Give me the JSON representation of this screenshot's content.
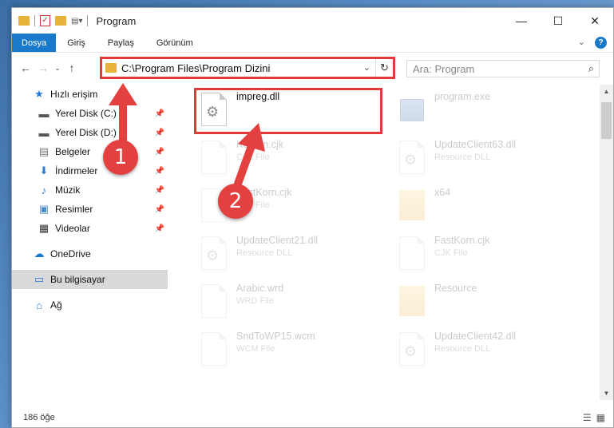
{
  "window": {
    "title": "Program",
    "controls": {
      "minimize": "—",
      "maximize": "☐",
      "close": "✕"
    }
  },
  "ribbon": {
    "tabs": [
      "Dosya",
      "Giriş",
      "Paylaş",
      "Görünüm"
    ],
    "active_tab": "Dosya",
    "expand": "⌄",
    "help": "?"
  },
  "address": {
    "path": "C:\\Program Files\\Program Dizini",
    "dropdown": "⌄",
    "refresh": "↻"
  },
  "search": {
    "placeholder": "Ara: Program",
    "icon": "search-icon"
  },
  "nav": {
    "items": [
      {
        "label": "Hızlı erişim",
        "icon": "star-icon",
        "pinned": false
      },
      {
        "label": "Yerel Disk (C:)",
        "icon": "drive-icon",
        "pinned": true
      },
      {
        "label": "Yerel Disk (D:)",
        "icon": "drive-icon",
        "pinned": true
      },
      {
        "label": "Belgeler",
        "icon": "documents-icon",
        "pinned": true
      },
      {
        "label": "İndirmeler",
        "icon": "download-icon",
        "pinned": true
      },
      {
        "label": "Müzik",
        "icon": "music-icon",
        "pinned": true
      },
      {
        "label": "Resimler",
        "icon": "pictures-icon",
        "pinned": true
      },
      {
        "label": "Videolar",
        "icon": "videos-icon",
        "pinned": true
      },
      {
        "label": "OneDrive",
        "icon": "cloud-icon"
      },
      {
        "label": "Bu bilgisayar",
        "icon": "computer-icon",
        "selected": true
      },
      {
        "label": "Ağ",
        "icon": "network-icon"
      }
    ]
  },
  "files": [
    {
      "name": "impreg.dll",
      "type": "",
      "kind": "dll",
      "highlighted": true
    },
    {
      "name": "program.exe",
      "type": "",
      "kind": "exe"
    },
    {
      "name": "Korean.cjk",
      "type": "CJK File",
      "kind": "doc"
    },
    {
      "name": "UpdateClient63.dll",
      "type": "Resource DLL",
      "kind": "dll"
    },
    {
      "name": "FastKorn.cjk",
      "type": "CJK File",
      "kind": "doc"
    },
    {
      "name": "x64",
      "type": "",
      "kind": "folder"
    },
    {
      "name": "UpdateClient21.dll",
      "type": "Resource DLL",
      "kind": "dll"
    },
    {
      "name": "FastKorn.cjk",
      "type": "CJK File",
      "kind": "doc"
    },
    {
      "name": "Arabic.wrd",
      "type": "WRD File",
      "kind": "doc"
    },
    {
      "name": "Resource",
      "type": "",
      "kind": "folder"
    },
    {
      "name": "SndToWP15.wcm",
      "type": "WCM File",
      "kind": "doc"
    },
    {
      "name": "UpdateClient42.dll",
      "type": "Resource DLL",
      "kind": "dll"
    }
  ],
  "status": {
    "count": "186 öğe"
  },
  "annotations": {
    "marker1": "1",
    "marker2": "2"
  },
  "colors": {
    "accent": "#1979ca",
    "highlight": "#e03a3a",
    "marker": "#e34040"
  }
}
